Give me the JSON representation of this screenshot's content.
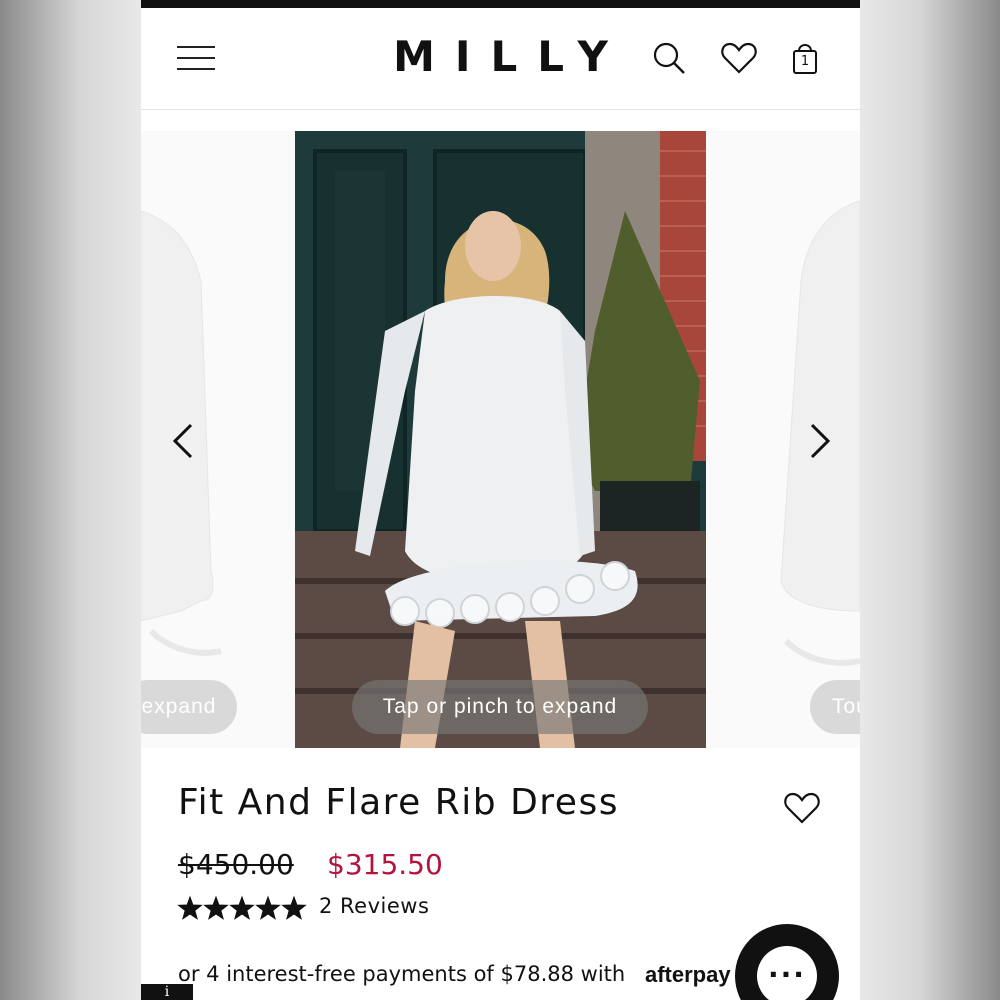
{
  "header": {
    "logo": "MILLY",
    "cart_count": "1"
  },
  "gallery": {
    "hint_text": "Tap or pinch to expand",
    "prev_slide_hint": "expand",
    "next_slide_hint": "Tou"
  },
  "product": {
    "title": "Fit And Flare Rib Dress",
    "original_price": "$450.00",
    "sale_price": "$315.50",
    "rating": 5,
    "rating_max": 5,
    "reviews_label": "2 Reviews",
    "installment_text": "or 4 interest-free payments of $78.88 with",
    "afterpay_brand": "afterpay"
  },
  "chat": {
    "label": "···"
  },
  "info_button": {
    "label": "i"
  },
  "colors": {
    "sale": "#b5123e",
    "text": "#111111",
    "background": "#ffffff"
  },
  "icons": [
    "menu-icon",
    "search-icon",
    "heart-icon",
    "bag-icon",
    "chevron-left-icon",
    "chevron-right-icon",
    "star-icon",
    "chat-icon",
    "info-icon"
  ]
}
